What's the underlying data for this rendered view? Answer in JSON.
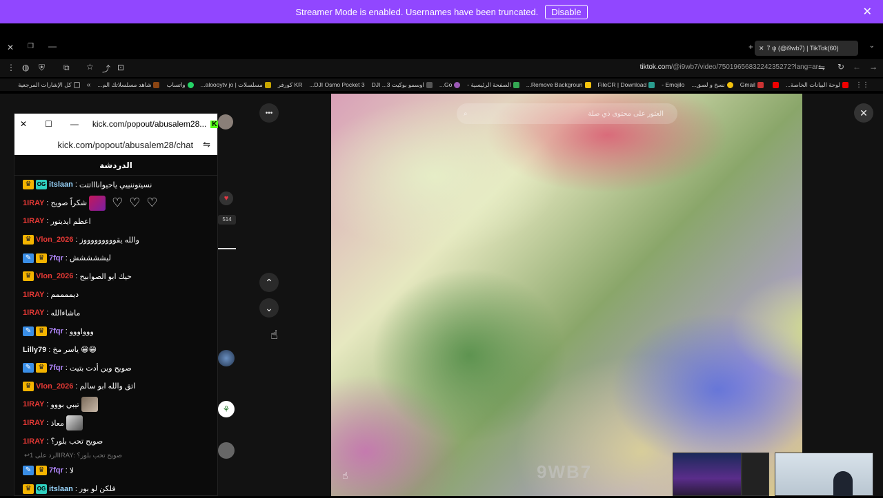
{
  "banner": {
    "text": "Streamer Mode is enabled. Usernames have been truncated.",
    "disable_label": "Disable",
    "close": "✕"
  },
  "browser": {
    "tab_title": "7 ψ (@i9wb7) | TikTok(60)",
    "url_host": "tiktok.com",
    "url_path": "/@i9wb7/video/7501965683224235272?lang=ar",
    "bookmarks": [
      {
        "label": "لوحة البيانات الخاصة...",
        "color": "#e00"
      },
      {
        "label": "",
        "color": "#e00"
      },
      {
        "label": "Gmail",
        "color": "#c33"
      },
      {
        "label": "نسخ و لصق...",
        "color": "#f4c20d"
      },
      {
        "label": "Emojilo -",
        "color": "#999"
      },
      {
        "label": "FileCR | Download",
        "color": "#2a9d8f"
      },
      {
        "label": "Remove Backgroun...",
        "color": "#f4c20d"
      },
      {
        "label": "الصفحة الرئيسية -",
        "color": "#34a853"
      },
      {
        "label": "Go...",
        "color": "#9b59b6"
      },
      {
        "label": "اوسمو بوكيت 3... DJI",
        "color": "#555"
      },
      {
        "label": "DJI Osmo Pocket 3...",
        "color": "#555"
      },
      {
        "label": "KR كورفر",
        "color": "#777"
      },
      {
        "label": "مسلسلات | aloooytv jo...",
        "color": "#c8a600"
      },
      {
        "label": "واتساب",
        "color": "#25d366"
      },
      {
        "label": "شاهد مسلسلاتك الم...",
        "color": "#8b4513"
      },
      {
        "label": "كل الإشارات المرجعية",
        "color": "#777"
      }
    ]
  },
  "tiktok": {
    "search_placeholder": "العثور على محتوى ذي صلة",
    "watermark": "9WB7",
    "more": "•••",
    "like_count": "514",
    "close": "✕"
  },
  "chat": {
    "window_title": "kick.com/popout/abusalem28...",
    "url": "kick.com/popout/abusalem28/chat",
    "title": "الدردشة",
    "messages": [
      {
        "badges": [
          "crown",
          "og"
        ],
        "user": "itslaan",
        "color": "#9ad7ff",
        "text": "نسيتوننييي ياحيواناااتتت"
      },
      {
        "badges": [],
        "user": "1IRAY",
        "color": "#e53935",
        "text": "شكراً صويح",
        "extra": "thumb-hearts"
      },
      {
        "badges": [],
        "user": "1IRAY",
        "color": "#e53935",
        "text": "اعظم ايديتور"
      },
      {
        "badges": [
          "crown"
        ],
        "user": "Vlon_2026",
        "color": "#e53935",
        "text": "والله يقوووووووووز"
      },
      {
        "badges": [
          "tool",
          "crown"
        ],
        "user": "7fqr",
        "color": "#b388ff",
        "text": "ليششششش"
      },
      {
        "badges": [
          "crown"
        ],
        "user": "Vlon_2026",
        "color": "#e53935",
        "text": "حيك ابو الصوابيح"
      },
      {
        "badges": [],
        "user": "1IRAY",
        "color": "#e53935",
        "text": "ديممممم"
      },
      {
        "badges": [],
        "user": "1IRAY",
        "color": "#e53935",
        "text": "ماشاءالله"
      },
      {
        "badges": [
          "tool",
          "crown"
        ],
        "user": "7fqr",
        "color": "#b388ff",
        "text": "ووواووو"
      },
      {
        "badges": [],
        "user": "Lilly79",
        "color": "#eeeeee",
        "text": "ياسر مخ 😁😁"
      },
      {
        "badges": [
          "tool",
          "crown"
        ],
        "user": "7fqr",
        "color": "#b388ff",
        "text": "صويح وين أدت بتيت"
      },
      {
        "badges": [
          "crown"
        ],
        "user": "Vlon_2026",
        "color": "#e53935",
        "text": "اتق والله ابو سالم"
      },
      {
        "badges": [],
        "user": "1IRAY",
        "color": "#e53935",
        "text": "تيبي بووو",
        "extra": "thumb"
      },
      {
        "badges": [],
        "user": "1IRAY",
        "color": "#e53935",
        "text": "معاذ",
        "extra": "thumb2"
      },
      {
        "badges": [],
        "user": "1IRAY",
        "color": "#e53935",
        "text": "صويح تحب بلور؟"
      }
    ],
    "reply_note": "الرد على 1IRAY: صويح تحب بلور؟",
    "messages_tail": [
      {
        "badges": [
          "tool",
          "crown"
        ],
        "user": "7fqr",
        "color": "#b388ff",
        "text": "لا"
      },
      {
        "badges": [
          "crown",
          "og"
        ],
        "user": "itslaan",
        "color": "#9ad7ff",
        "text": "فلكن لو بور"
      }
    ]
  }
}
